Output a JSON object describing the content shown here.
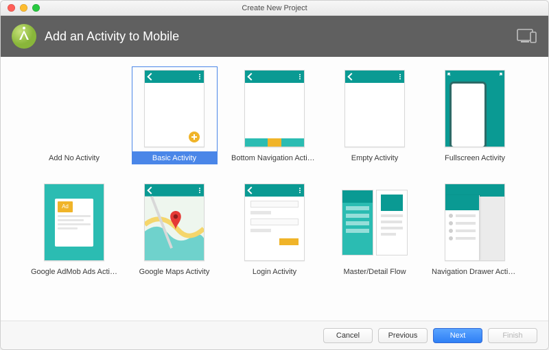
{
  "window": {
    "title": "Create New Project"
  },
  "header": {
    "title": "Add an Activity to Mobile"
  },
  "tiles": [
    {
      "label": "Add No Activity",
      "selected": false
    },
    {
      "label": "Basic Activity",
      "selected": true
    },
    {
      "label": "Bottom Navigation Activity",
      "selected": false
    },
    {
      "label": "Empty Activity",
      "selected": false
    },
    {
      "label": "Fullscreen Activity",
      "selected": false
    },
    {
      "label": "Google AdMob Ads Activity",
      "selected": false
    },
    {
      "label": "Google Maps Activity",
      "selected": false
    },
    {
      "label": "Login Activity",
      "selected": false
    },
    {
      "label": "Master/Detail Flow",
      "selected": false
    },
    {
      "label": "Navigation Drawer Activity",
      "selected": false
    }
  ],
  "admob": {
    "tag": "Ad"
  },
  "footer": {
    "cancel": "Cancel",
    "previous": "Previous",
    "next": "Next",
    "finish": "Finish"
  }
}
